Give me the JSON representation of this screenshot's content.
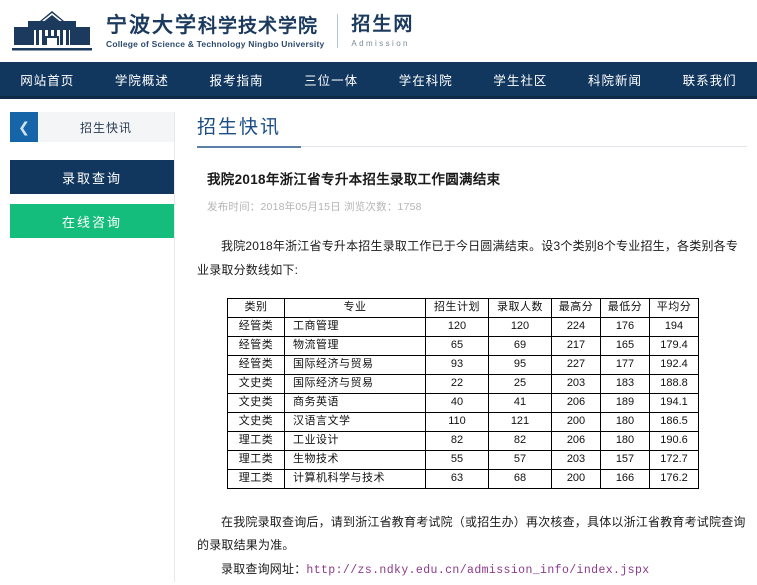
{
  "header": {
    "logo_icon": "university-building-icon",
    "brand_cn_primary": "宁波大学",
    "brand_cn_secondary": "科学技术学院",
    "brand_en": "College of Science & Technology  Ningbo University",
    "section_cn": "招生网",
    "section_en": "Admission"
  },
  "nav": {
    "items": [
      {
        "label": "网站首页"
      },
      {
        "label": "学院概述"
      },
      {
        "label": "报考指南"
      },
      {
        "label": "三位一体"
      },
      {
        "label": "学在科院"
      },
      {
        "label": "学生社区"
      },
      {
        "label": "科院新闻"
      },
      {
        "label": "联系我们"
      }
    ]
  },
  "sidebar": {
    "back_icon": "chevron-left-icon",
    "panel_title": "招生快讯",
    "buttons": [
      {
        "label": "录取查询",
        "color": "#11375f"
      },
      {
        "label": "在线咨询",
        "color": "#15bd7c"
      }
    ]
  },
  "content": {
    "section_title": "招生快讯",
    "article_title": "我院2018年浙江省专升本招生录取工作圆满结束",
    "meta": "发布时间：2018年05月15日 浏览次数：1758",
    "intro_paragraph": "我院2018年浙江省专升本招生录取工作已于今日圆满结束。设3个类别8个专业招生，各类别各专业录取分数线如下:",
    "closing_paragraph": "在我院录取查询后，请到浙江省教育考试院（或招生办）再次核查，具体以浙江省教育考试院查询的录取结果为准。",
    "url_label": "录取查询网址：",
    "url_value": "http://zs.ndky.edu.cn/admission_info/index.jspx"
  },
  "chart_data": {
    "type": "table",
    "title": "2018年浙江省专升本各类别各专业录取分数线",
    "columns": [
      "类别",
      "专业",
      "招生计划",
      "录取人数",
      "最高分",
      "最低分",
      "平均分"
    ],
    "rows": [
      [
        "经管类",
        "工商管理",
        "120",
        "120",
        "224",
        "176",
        "194"
      ],
      [
        "经管类",
        "物流管理",
        "65",
        "69",
        "217",
        "165",
        "179.4"
      ],
      [
        "经管类",
        "国际经济与贸易",
        "93",
        "95",
        "227",
        "177",
        "192.4"
      ],
      [
        "文史类",
        "国际经济与贸易",
        "22",
        "25",
        "203",
        "183",
        "188.8"
      ],
      [
        "文史类",
        "商务英语",
        "40",
        "41",
        "206",
        "189",
        "194.1"
      ],
      [
        "文史类",
        "汉语言文学",
        "110",
        "121",
        "200",
        "180",
        "186.5"
      ],
      [
        "理工类",
        "工业设计",
        "82",
        "82",
        "206",
        "180",
        "190.6"
      ],
      [
        "理工类",
        "生物技术",
        "55",
        "57",
        "203",
        "157",
        "172.7"
      ],
      [
        "理工类",
        "计算机科学与技术",
        "63",
        "68",
        "200",
        "166",
        "176.2"
      ]
    ]
  },
  "colors": {
    "nav_bg": "#11375f",
    "brand_blue": "#1b3a5e",
    "accent_green": "#15bd7c",
    "title_blue": "#1b4e86",
    "link_purple": "#8a3a8a"
  }
}
